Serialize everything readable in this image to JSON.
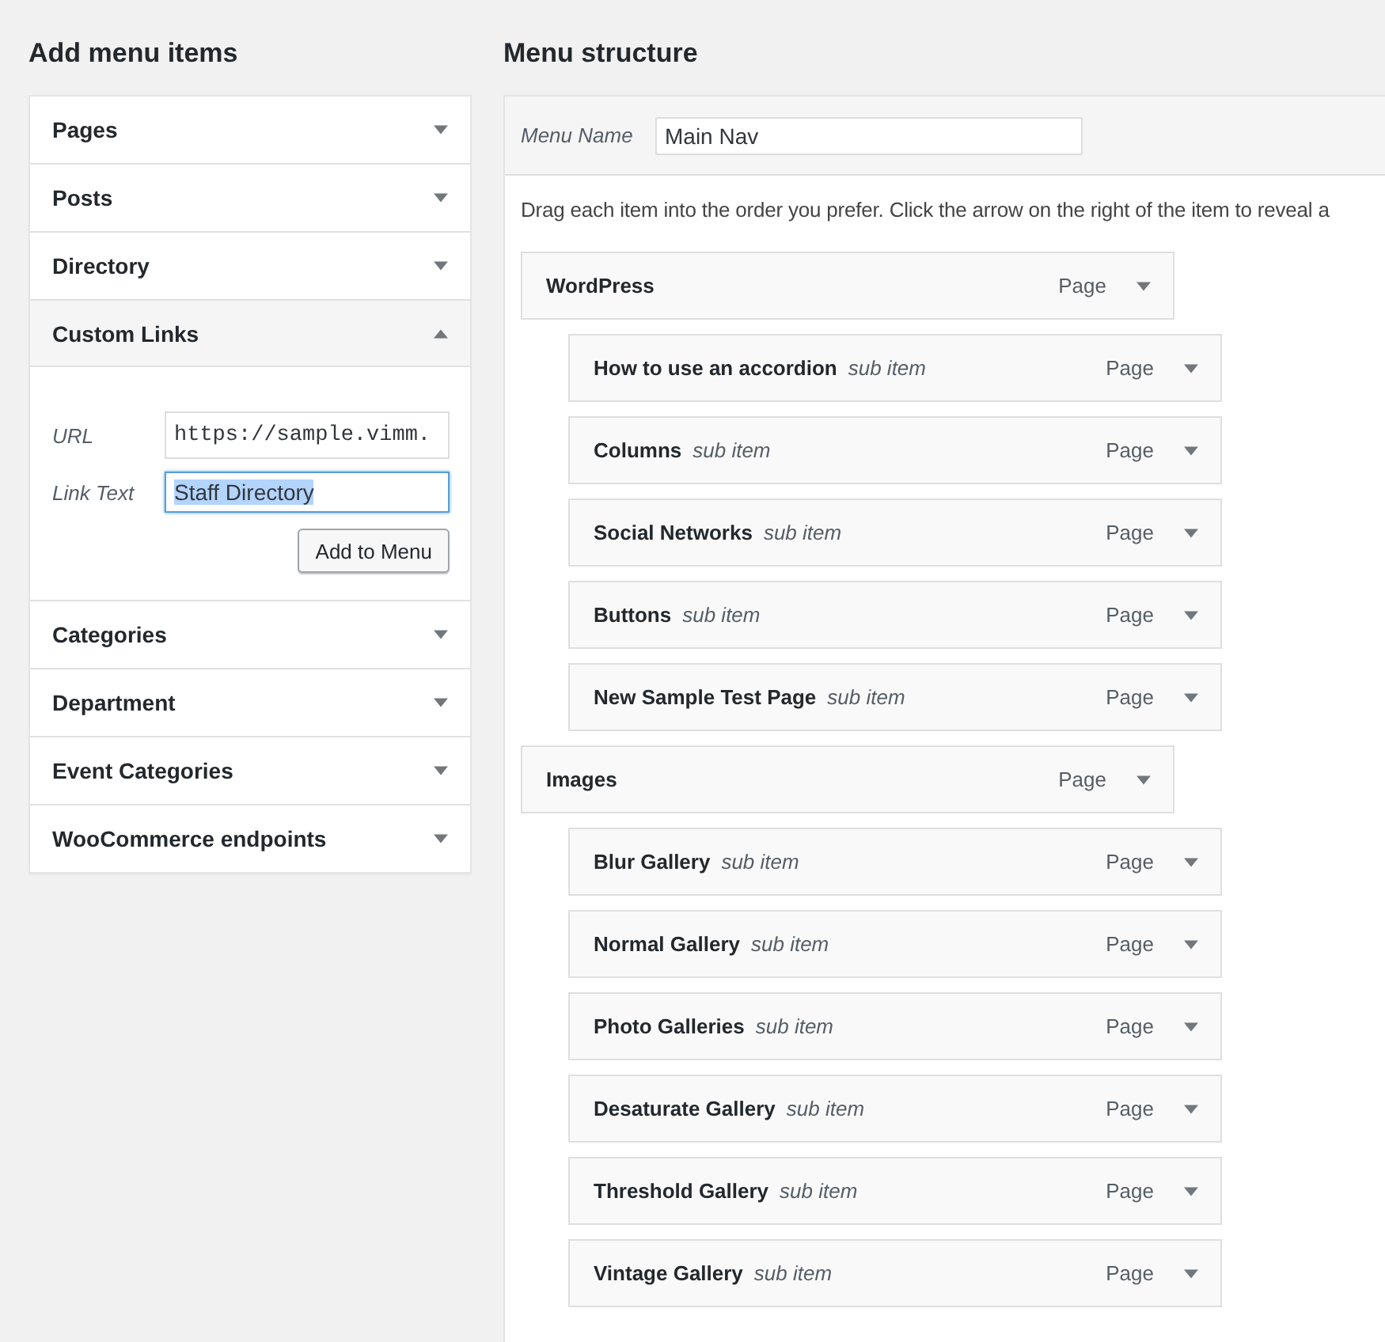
{
  "add_menu_items": {
    "title": "Add menu items",
    "sections": [
      {
        "label": "Pages",
        "expanded": false
      },
      {
        "label": "Posts",
        "expanded": false
      },
      {
        "label": "Directory",
        "expanded": false
      },
      {
        "label": "Custom Links",
        "expanded": true,
        "fields": [
          {
            "label": "URL",
            "value": "https://sample.vimm.",
            "kind": "mono",
            "selected": false
          },
          {
            "label": "Link Text",
            "value": "Staff Directory",
            "kind": "text",
            "selected": true
          }
        ],
        "button": "Add to Menu"
      },
      {
        "label": "Categories",
        "expanded": false
      },
      {
        "label": "Department",
        "expanded": false
      },
      {
        "label": "Event Categories",
        "expanded": false
      },
      {
        "label": "WooCommerce endpoints",
        "expanded": false
      }
    ]
  },
  "menu_structure": {
    "title": "Menu structure",
    "menu_name": {
      "label": "Menu Name",
      "value": "Main Nav"
    },
    "instructions": "Drag each item into the order you prefer. Click the arrow on the right of the item to reveal a",
    "items": [
      {
        "title": "WordPress",
        "type": "Page",
        "children": [
          {
            "title": "How to use an accordion",
            "subtitle": "sub item",
            "type": "Page"
          },
          {
            "title": "Columns",
            "subtitle": "sub item",
            "type": "Page"
          },
          {
            "title": "Social Networks",
            "subtitle": "sub item",
            "type": "Page"
          },
          {
            "title": "Buttons",
            "subtitle": "sub item",
            "type": "Page"
          },
          {
            "title": "New Sample Test Page",
            "subtitle": "sub item",
            "type": "Page"
          }
        ]
      },
      {
        "title": "Images",
        "type": "Page",
        "children": [
          {
            "title": "Blur Gallery",
            "subtitle": "sub item",
            "type": "Page"
          },
          {
            "title": "Normal Gallery",
            "subtitle": "sub item",
            "type": "Page"
          },
          {
            "title": "Photo Galleries",
            "subtitle": "sub item",
            "type": "Page"
          },
          {
            "title": "Desaturate Gallery",
            "subtitle": "sub item",
            "type": "Page"
          },
          {
            "title": "Threshold Gallery",
            "subtitle": "sub item",
            "type": "Page"
          },
          {
            "title": "Vintage Gallery",
            "subtitle": "sub item",
            "type": "Page"
          }
        ]
      }
    ]
  }
}
